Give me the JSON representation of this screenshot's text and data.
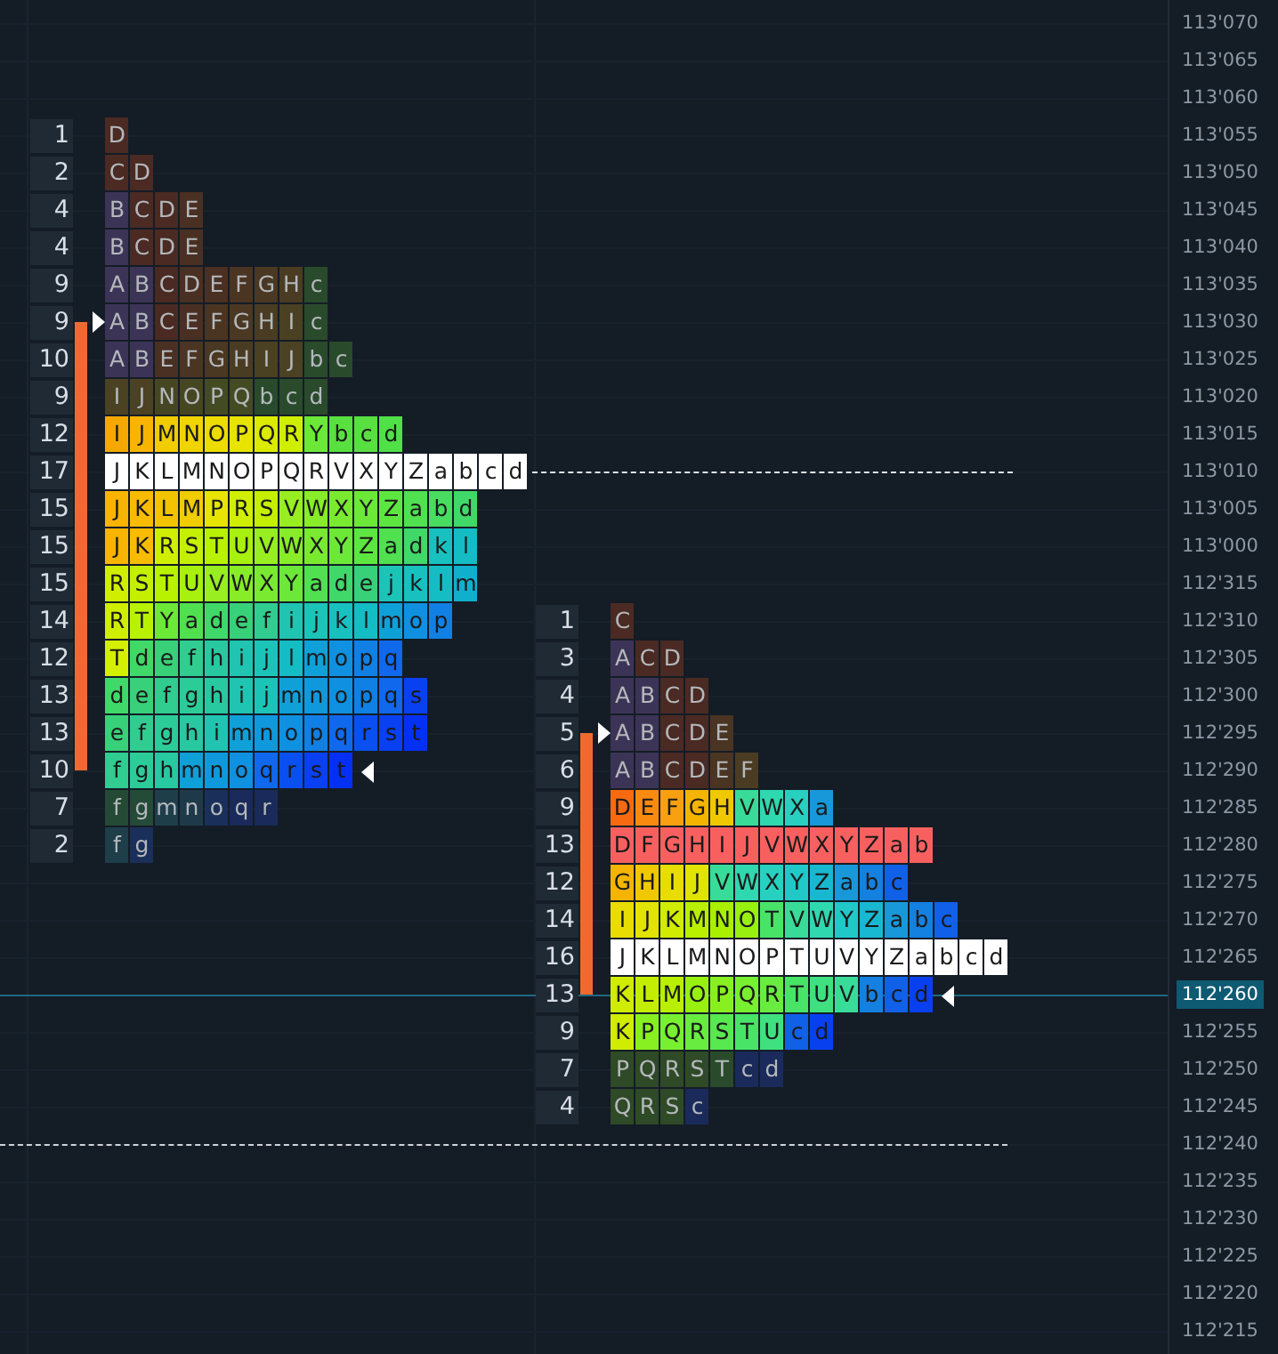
{
  "price_axis": {
    "labels": [
      {
        "text": "113'070",
        "selected": false
      },
      {
        "text": "113'065",
        "selected": false
      },
      {
        "text": "113'060",
        "selected": false
      },
      {
        "text": "113'055",
        "selected": false
      },
      {
        "text": "113'050",
        "selected": false
      },
      {
        "text": "113'045",
        "selected": false
      },
      {
        "text": "113'040",
        "selected": false
      },
      {
        "text": "113'035",
        "selected": false
      },
      {
        "text": "113'030",
        "selected": false
      },
      {
        "text": "113'025",
        "selected": false
      },
      {
        "text": "113'020",
        "selected": false
      },
      {
        "text": "113'015",
        "selected": false
      },
      {
        "text": "113'010",
        "selected": false
      },
      {
        "text": "113'005",
        "selected": false
      },
      {
        "text": "113'000",
        "selected": false
      },
      {
        "text": "112'315",
        "selected": false
      },
      {
        "text": "112'310",
        "selected": false
      },
      {
        "text": "112'305",
        "selected": false
      },
      {
        "text": "112'300",
        "selected": false
      },
      {
        "text": "112'295",
        "selected": false
      },
      {
        "text": "112'290",
        "selected": false
      },
      {
        "text": "112'285",
        "selected": false
      },
      {
        "text": "112'280",
        "selected": false
      },
      {
        "text": "112'275",
        "selected": false
      },
      {
        "text": "112'270",
        "selected": false
      },
      {
        "text": "112'265",
        "selected": false
      },
      {
        "text": "112'260",
        "selected": true
      },
      {
        "text": "112'255",
        "selected": false
      },
      {
        "text": "112'250",
        "selected": false
      },
      {
        "text": "112'245",
        "selected": false
      },
      {
        "text": "112'240",
        "selected": false
      },
      {
        "text": "112'235",
        "selected": false
      },
      {
        "text": "112'230",
        "selected": false
      },
      {
        "text": "112'225",
        "selected": false
      },
      {
        "text": "112'220",
        "selected": false
      },
      {
        "text": "112'215",
        "selected": false
      }
    ]
  },
  "profiles": [
    {
      "rows": [
        {
          "count": "1",
          "dim": true,
          "cells": [
            {
              "letter": "D",
              "color": "#4a2a22"
            }
          ]
        },
        {
          "count": "2",
          "dim": true,
          "cells": [
            {
              "letter": "C",
              "color": "#4a2a22"
            },
            {
              "letter": "D",
              "color": "#4a2a22"
            }
          ]
        },
        {
          "count": "4",
          "dim": true,
          "cells": [
            {
              "letter": "B",
              "color": "#3c3456"
            },
            {
              "letter": "C",
              "color": "#4a2a22"
            },
            {
              "letter": "D",
              "color": "#4a2a22"
            },
            {
              "letter": "E",
              "color": "#4a3022"
            }
          ]
        },
        {
          "count": "4",
          "dim": true,
          "cells": [
            {
              "letter": "B",
              "color": "#3c3456"
            },
            {
              "letter": "C",
              "color": "#4a2a22"
            },
            {
              "letter": "D",
              "color": "#4a2a22"
            },
            {
              "letter": "E",
              "color": "#4a3022"
            }
          ]
        },
        {
          "count": "9",
          "dim": true,
          "cells": [
            {
              "letter": "A",
              "color": "#3c3456"
            },
            {
              "letter": "B",
              "color": "#3c3456"
            },
            {
              "letter": "C",
              "color": "#4a2a22"
            },
            {
              "letter": "D",
              "color": "#4a3022"
            },
            {
              "letter": "E",
              "color": "#4a3022"
            },
            {
              "letter": "F",
              "color": "#4a3422"
            },
            {
              "letter": "G",
              "color": "#4a3822"
            },
            {
              "letter": "H",
              "color": "#4a3c22"
            },
            {
              "letter": "c",
              "color": "#2a4a2c"
            }
          ]
        },
        {
          "count": "9",
          "dim": true,
          "cells": [
            {
              "letter": "A",
              "color": "#3c3456"
            },
            {
              "letter": "B",
              "color": "#3c3456"
            },
            {
              "letter": "C",
              "color": "#4a2a22"
            },
            {
              "letter": "E",
              "color": "#4a3022"
            },
            {
              "letter": "F",
              "color": "#4a3422"
            },
            {
              "letter": "G",
              "color": "#4a3822"
            },
            {
              "letter": "H",
              "color": "#4a3c22"
            },
            {
              "letter": "I",
              "color": "#4a4022"
            },
            {
              "letter": "c",
              "color": "#2a4a2c"
            }
          ]
        },
        {
          "count": "10",
          "dim": true,
          "cells": [
            {
              "letter": "A",
              "color": "#3c3456"
            },
            {
              "letter": "B",
              "color": "#3c3456"
            },
            {
              "letter": "E",
              "color": "#4a3022"
            },
            {
              "letter": "F",
              "color": "#4a3422"
            },
            {
              "letter": "G",
              "color": "#4a3822"
            },
            {
              "letter": "H",
              "color": "#4a3c22"
            },
            {
              "letter": "I",
              "color": "#4a4022"
            },
            {
              "letter": "J",
              "color": "#4a4222"
            },
            {
              "letter": "b",
              "color": "#2a4a2c"
            },
            {
              "letter": "c",
              "color": "#2a4a2c"
            }
          ]
        },
        {
          "count": "9",
          "dim": true,
          "cells": [
            {
              "letter": "I",
              "color": "#4a4222"
            },
            {
              "letter": "J",
              "color": "#4a4222"
            },
            {
              "letter": "N",
              "color": "#464622"
            },
            {
              "letter": "O",
              "color": "#464622"
            },
            {
              "letter": "P",
              "color": "#444a22"
            },
            {
              "letter": "Q",
              "color": "#444a22"
            },
            {
              "letter": "b",
              "color": "#2a4a2c"
            },
            {
              "letter": "c",
              "color": "#2a4a2c"
            },
            {
              "letter": "d",
              "color": "#2a4a2c"
            }
          ]
        },
        {
          "count": "12",
          "dim": false,
          "cells": [
            {
              "letter": "I",
              "color": "#f5a800"
            },
            {
              "letter": "J",
              "color": "#f7b400"
            },
            {
              "letter": "M",
              "color": "#f0cc00"
            },
            {
              "letter": "N",
              "color": "#efd400"
            },
            {
              "letter": "O",
              "color": "#ecdc00"
            },
            {
              "letter": "P",
              "color": "#e6e400"
            },
            {
              "letter": "Q",
              "color": "#dcea00"
            },
            {
              "letter": "R",
              "color": "#d0ee00"
            },
            {
              "letter": "Y",
              "color": "#6ce838"
            },
            {
              "letter": "b",
              "color": "#58e040"
            },
            {
              "letter": "c",
              "color": "#58e040"
            },
            {
              "letter": "d",
              "color": "#50e048"
            }
          ]
        },
        {
          "count": "17",
          "dim": false,
          "cells": [
            {
              "letter": "J",
              "color": "#ffffff"
            },
            {
              "letter": "K",
              "color": "#ffffff"
            },
            {
              "letter": "L",
              "color": "#ffffff"
            },
            {
              "letter": "M",
              "color": "#ffffff"
            },
            {
              "letter": "N",
              "color": "#ffffff"
            },
            {
              "letter": "O",
              "color": "#ffffff"
            },
            {
              "letter": "P",
              "color": "#ffffff"
            },
            {
              "letter": "Q",
              "color": "#ffffff"
            },
            {
              "letter": "R",
              "color": "#ffffff"
            },
            {
              "letter": "V",
              "color": "#ffffff"
            },
            {
              "letter": "X",
              "color": "#ffffff"
            },
            {
              "letter": "Y",
              "color": "#ffffff"
            },
            {
              "letter": "Z",
              "color": "#ffffff"
            },
            {
              "letter": "a",
              "color": "#ffffff"
            },
            {
              "letter": "b",
              "color": "#ffffff"
            },
            {
              "letter": "c",
              "color": "#ffffff"
            },
            {
              "letter": "d",
              "color": "#ffffff"
            }
          ]
        },
        {
          "count": "15",
          "dim": false,
          "cells": [
            {
              "letter": "J",
              "color": "#f7b400"
            },
            {
              "letter": "K",
              "color": "#f7bc00"
            },
            {
              "letter": "L",
              "color": "#f2c400"
            },
            {
              "letter": "M",
              "color": "#f0cc00"
            },
            {
              "letter": "P",
              "color": "#e6e400"
            },
            {
              "letter": "R",
              "color": "#d0ee00"
            },
            {
              "letter": "S",
              "color": "#c4f000"
            },
            {
              "letter": "V",
              "color": "#98ee20"
            },
            {
              "letter": "W",
              "color": "#88ec28"
            },
            {
              "letter": "X",
              "color": "#7aea30"
            },
            {
              "letter": "Y",
              "color": "#6ce838"
            },
            {
              "letter": "Z",
              "color": "#5ee640"
            },
            {
              "letter": "a",
              "color": "#50e050"
            },
            {
              "letter": "b",
              "color": "#48dc60"
            },
            {
              "letter": "d",
              "color": "#40d868"
            }
          ]
        },
        {
          "count": "15",
          "dim": false,
          "cells": [
            {
              "letter": "J",
              "color": "#f7b400"
            },
            {
              "letter": "K",
              "color": "#f7bc00"
            },
            {
              "letter": "R",
              "color": "#d0ee00"
            },
            {
              "letter": "S",
              "color": "#c4f000"
            },
            {
              "letter": "T",
              "color": "#b8f200"
            },
            {
              "letter": "U",
              "color": "#a8f010"
            },
            {
              "letter": "V",
              "color": "#98ee20"
            },
            {
              "letter": "W",
              "color": "#88ec28"
            },
            {
              "letter": "X",
              "color": "#7aea30"
            },
            {
              "letter": "Y",
              "color": "#6ce838"
            },
            {
              "letter": "Z",
              "color": "#5ee640"
            },
            {
              "letter": "a",
              "color": "#50e050"
            },
            {
              "letter": "d",
              "color": "#40d868"
            },
            {
              "letter": "k",
              "color": "#18c0c0"
            },
            {
              "letter": "l",
              "color": "#14bcc4"
            }
          ]
        },
        {
          "count": "15",
          "dim": false,
          "cells": [
            {
              "letter": "R",
              "color": "#d0ee00"
            },
            {
              "letter": "S",
              "color": "#c4f000"
            },
            {
              "letter": "T",
              "color": "#b8f200"
            },
            {
              "letter": "U",
              "color": "#a8f010"
            },
            {
              "letter": "V",
              "color": "#98ee20"
            },
            {
              "letter": "W",
              "color": "#88ec28"
            },
            {
              "letter": "X",
              "color": "#7aea30"
            },
            {
              "letter": "Y",
              "color": "#6ce838"
            },
            {
              "letter": "a",
              "color": "#50e050"
            },
            {
              "letter": "d",
              "color": "#40d868"
            },
            {
              "letter": "e",
              "color": "#38d078"
            },
            {
              "letter": "j",
              "color": "#1cc4b8"
            },
            {
              "letter": "k",
              "color": "#18c0c0"
            },
            {
              "letter": "l",
              "color": "#14bcc4"
            },
            {
              "letter": "m",
              "color": "#10b0cc"
            }
          ]
        },
        {
          "count": "14",
          "dim": false,
          "cells": [
            {
              "letter": "R",
              "color": "#d0ee00"
            },
            {
              "letter": "T",
              "color": "#b8f200"
            },
            {
              "letter": "Y",
              "color": "#6ce838"
            },
            {
              "letter": "a",
              "color": "#50e050"
            },
            {
              "letter": "d",
              "color": "#40d868"
            },
            {
              "letter": "e",
              "color": "#38d078"
            },
            {
              "letter": "f",
              "color": "#30cc90"
            },
            {
              "letter": "i",
              "color": "#20c4b0"
            },
            {
              "letter": "j",
              "color": "#1cc4b8"
            },
            {
              "letter": "k",
              "color": "#18c0c0"
            },
            {
              "letter": "l",
              "color": "#14bcc4"
            },
            {
              "letter": "m",
              "color": "#10a0d8"
            },
            {
              "letter": "o",
              "color": "#1090e0"
            },
            {
              "letter": "p",
              "color": "#1080e4"
            }
          ]
        },
        {
          "count": "12",
          "dim": false,
          "cells": [
            {
              "letter": "T",
              "color": "#d4f000"
            },
            {
              "letter": "d",
              "color": "#40d868"
            },
            {
              "letter": "e",
              "color": "#38d078"
            },
            {
              "letter": "f",
              "color": "#30cc90"
            },
            {
              "letter": "h",
              "color": "#28c8a0"
            },
            {
              "letter": "i",
              "color": "#20c4b0"
            },
            {
              "letter": "j",
              "color": "#1cc4b8"
            },
            {
              "letter": "l",
              "color": "#14bcc4"
            },
            {
              "letter": "m",
              "color": "#10a0d8"
            },
            {
              "letter": "o",
              "color": "#1090e0"
            },
            {
              "letter": "p",
              "color": "#1080e4"
            },
            {
              "letter": "q",
              "color": "#1068ec"
            }
          ]
        },
        {
          "count": "13",
          "dim": false,
          "cells": [
            {
              "letter": "d",
              "color": "#40d868"
            },
            {
              "letter": "e",
              "color": "#38d078"
            },
            {
              "letter": "f",
              "color": "#30cc90"
            },
            {
              "letter": "g",
              "color": "#2ccc98"
            },
            {
              "letter": "h",
              "color": "#28c8a0"
            },
            {
              "letter": "i",
              "color": "#20c4b0"
            },
            {
              "letter": "j",
              "color": "#1cc4b8"
            },
            {
              "letter": "m",
              "color": "#10a0d8"
            },
            {
              "letter": "n",
              "color": "#1098dc"
            },
            {
              "letter": "o",
              "color": "#1090e0"
            },
            {
              "letter": "p",
              "color": "#1080e4"
            },
            {
              "letter": "q",
              "color": "#1068ec"
            },
            {
              "letter": "s",
              "color": "#0840f2"
            }
          ]
        },
        {
          "count": "13",
          "dim": false,
          "cells": [
            {
              "letter": "e",
              "color": "#38d078"
            },
            {
              "letter": "f",
              "color": "#30cc90"
            },
            {
              "letter": "g",
              "color": "#2ccc98"
            },
            {
              "letter": "h",
              "color": "#28c8a0"
            },
            {
              "letter": "i",
              "color": "#20c4b0"
            },
            {
              "letter": "m",
              "color": "#10a0d8"
            },
            {
              "letter": "n",
              "color": "#1098dc"
            },
            {
              "letter": "o",
              "color": "#1090e0"
            },
            {
              "letter": "p",
              "color": "#1080e4"
            },
            {
              "letter": "q",
              "color": "#1068ec"
            },
            {
              "letter": "r",
              "color": "#0a50f0"
            },
            {
              "letter": "s",
              "color": "#0840f2"
            },
            {
              "letter": "t",
              "color": "#0430f4"
            }
          ]
        },
        {
          "count": "10",
          "dim": false,
          "cells": [
            {
              "letter": "f",
              "color": "#30cc90"
            },
            {
              "letter": "g",
              "color": "#2ccc98"
            },
            {
              "letter": "h",
              "color": "#28c8a0"
            },
            {
              "letter": "m",
              "color": "#10a0d8"
            },
            {
              "letter": "n",
              "color": "#1098dc"
            },
            {
              "letter": "o",
              "color": "#1090e0"
            },
            {
              "letter": "q",
              "color": "#1068ec"
            },
            {
              "letter": "r",
              "color": "#0a50f0"
            },
            {
              "letter": "s",
              "color": "#0840f2"
            },
            {
              "letter": "t",
              "color": "#0430f4"
            }
          ]
        },
        {
          "count": "7",
          "dim": true,
          "cells": [
            {
              "letter": "f",
              "color": "#244a36"
            },
            {
              "letter": "g",
              "color": "#244a38"
            },
            {
              "letter": "m",
              "color": "#1e3e4a"
            },
            {
              "letter": "n",
              "color": "#1e3a4a"
            },
            {
              "letter": "o",
              "color": "#1a305a"
            },
            {
              "letter": "q",
              "color": "#1a2a5a"
            },
            {
              "letter": "r",
              "color": "#1a2a5a"
            }
          ]
        },
        {
          "count": "2",
          "dim": true,
          "cells": [
            {
              "letter": "f",
              "color": "#1e3e4a"
            },
            {
              "letter": "g",
              "color": "#1a305a"
            }
          ]
        }
      ]
    },
    {
      "rows": [
        {
          "count": "1",
          "dim": true,
          "cells": [
            {
              "letter": "C",
              "color": "#4a2a22"
            }
          ]
        },
        {
          "count": "3",
          "dim": true,
          "cells": [
            {
              "letter": "A",
              "color": "#3c3456"
            },
            {
              "letter": "C",
              "color": "#4a2a22"
            },
            {
              "letter": "D",
              "color": "#4a2a22"
            }
          ]
        },
        {
          "count": "4",
          "dim": true,
          "cells": [
            {
              "letter": "A",
              "color": "#3c3456"
            },
            {
              "letter": "B",
              "color": "#3c3456"
            },
            {
              "letter": "C",
              "color": "#4a2a22"
            },
            {
              "letter": "D",
              "color": "#4a2a22"
            }
          ]
        },
        {
          "count": "5",
          "dim": true,
          "cells": [
            {
              "letter": "A",
              "color": "#3c3456"
            },
            {
              "letter": "B",
              "color": "#3c3456"
            },
            {
              "letter": "C",
              "color": "#4a2a22"
            },
            {
              "letter": "D",
              "color": "#4a2a22"
            },
            {
              "letter": "E",
              "color": "#4a3422"
            }
          ]
        },
        {
          "count": "6",
          "dim": true,
          "cells": [
            {
              "letter": "A",
              "color": "#3c3456"
            },
            {
              "letter": "B",
              "color": "#3c3456"
            },
            {
              "letter": "C",
              "color": "#4a2a22"
            },
            {
              "letter": "D",
              "color": "#4a2a22"
            },
            {
              "letter": "E",
              "color": "#4a3422"
            },
            {
              "letter": "F",
              "color": "#4a3c22"
            }
          ]
        },
        {
          "count": "9",
          "dim": false,
          "cells": [
            {
              "letter": "D",
              "color": "#f86a10"
            },
            {
              "letter": "E",
              "color": "#f88a10"
            },
            {
              "letter": "F",
              "color": "#f8a010"
            },
            {
              "letter": "G",
              "color": "#f4b400"
            },
            {
              "letter": "H",
              "color": "#f0c800"
            },
            {
              "letter": "V",
              "color": "#38dc98"
            },
            {
              "letter": "W",
              "color": "#30d8b0"
            },
            {
              "letter": "X",
              "color": "#28d0c0"
            },
            {
              "letter": "a",
              "color": "#1898d8"
            }
          ]
        },
        {
          "count": "13",
          "dim": false,
          "cells": [
            {
              "letter": "D",
              "color": "#f86060"
            },
            {
              "letter": "F",
              "color": "#f86060"
            },
            {
              "letter": "G",
              "color": "#f86060"
            },
            {
              "letter": "H",
              "color": "#f86060"
            },
            {
              "letter": "I",
              "color": "#f86060"
            },
            {
              "letter": "J",
              "color": "#f86060"
            },
            {
              "letter": "V",
              "color": "#f86060"
            },
            {
              "letter": "W",
              "color": "#f86060"
            },
            {
              "letter": "X",
              "color": "#f86060"
            },
            {
              "letter": "Y",
              "color": "#f86060"
            },
            {
              "letter": "Z",
              "color": "#f86060"
            },
            {
              "letter": "a",
              "color": "#f86060"
            },
            {
              "letter": "b",
              "color": "#f86060"
            }
          ]
        },
        {
          "count": "12",
          "dim": false,
          "cells": [
            {
              "letter": "G",
              "color": "#f4b400"
            },
            {
              "letter": "H",
              "color": "#f0c800"
            },
            {
              "letter": "I",
              "color": "#e8dc00"
            },
            {
              "letter": "J",
              "color": "#e0e400"
            },
            {
              "letter": "V",
              "color": "#38dc98"
            },
            {
              "letter": "W",
              "color": "#30d8b0"
            },
            {
              "letter": "X",
              "color": "#28d0c0"
            },
            {
              "letter": "Y",
              "color": "#20c8c8"
            },
            {
              "letter": "Z",
              "color": "#18b8d0"
            },
            {
              "letter": "a",
              "color": "#1898d8"
            },
            {
              "letter": "b",
              "color": "#1480e0"
            },
            {
              "letter": "c",
              "color": "#1060e8"
            }
          ]
        },
        {
          "count": "14",
          "dim": false,
          "cells": [
            {
              "letter": "I",
              "color": "#e8dc00"
            },
            {
              "letter": "J",
              "color": "#e0e400"
            },
            {
              "letter": "K",
              "color": "#d0ec00"
            },
            {
              "letter": "M",
              "color": "#b8f000"
            },
            {
              "letter": "N",
              "color": "#a8f000"
            },
            {
              "letter": "O",
              "color": "#98f010"
            },
            {
              "letter": "T",
              "color": "#48e468"
            },
            {
              "letter": "V",
              "color": "#38dc98"
            },
            {
              "letter": "W",
              "color": "#30d8b0"
            },
            {
              "letter": "Y",
              "color": "#20c8c8"
            },
            {
              "letter": "Z",
              "color": "#18b8d0"
            },
            {
              "letter": "a",
              "color": "#1898d8"
            },
            {
              "letter": "b",
              "color": "#1480e0"
            },
            {
              "letter": "c",
              "color": "#1060e8"
            }
          ]
        },
        {
          "count": "16",
          "dim": false,
          "cells": [
            {
              "letter": "J",
              "color": "#ffffff"
            },
            {
              "letter": "K",
              "color": "#ffffff"
            },
            {
              "letter": "L",
              "color": "#ffffff"
            },
            {
              "letter": "M",
              "color": "#ffffff"
            },
            {
              "letter": "N",
              "color": "#ffffff"
            },
            {
              "letter": "O",
              "color": "#ffffff"
            },
            {
              "letter": "P",
              "color": "#ffffff"
            },
            {
              "letter": "T",
              "color": "#ffffff"
            },
            {
              "letter": "U",
              "color": "#ffffff"
            },
            {
              "letter": "V",
              "color": "#ffffff"
            },
            {
              "letter": "Y",
              "color": "#ffffff"
            },
            {
              "letter": "Z",
              "color": "#ffffff"
            },
            {
              "letter": "a",
              "color": "#ffffff"
            },
            {
              "letter": "b",
              "color": "#ffffff"
            },
            {
              "letter": "c",
              "color": "#ffffff"
            },
            {
              "letter": "d",
              "color": "#ffffff"
            }
          ]
        },
        {
          "count": "13",
          "dim": false,
          "cells": [
            {
              "letter": "K",
              "color": "#d0ec00"
            },
            {
              "letter": "L",
              "color": "#c4ee00"
            },
            {
              "letter": "M",
              "color": "#b8f000"
            },
            {
              "letter": "O",
              "color": "#98f010"
            },
            {
              "letter": "P",
              "color": "#88f020"
            },
            {
              "letter": "Q",
              "color": "#78f030"
            },
            {
              "letter": "R",
              "color": "#68ec40"
            },
            {
              "letter": "T",
              "color": "#48e468"
            },
            {
              "letter": "U",
              "color": "#40e080"
            },
            {
              "letter": "V",
              "color": "#38dc98"
            },
            {
              "letter": "b",
              "color": "#1480e0"
            },
            {
              "letter": "c",
              "color": "#1060e8"
            },
            {
              "letter": "d",
              "color": "#0840f0"
            }
          ]
        },
        {
          "count": "9",
          "dim": false,
          "cells": [
            {
              "letter": "K",
              "color": "#d0ec00"
            },
            {
              "letter": "P",
              "color": "#88f020"
            },
            {
              "letter": "Q",
              "color": "#78f030"
            },
            {
              "letter": "R",
              "color": "#68ec40"
            },
            {
              "letter": "S",
              "color": "#58e850"
            },
            {
              "letter": "T",
              "color": "#48e468"
            },
            {
              "letter": "U",
              "color": "#40e080"
            },
            {
              "letter": "c",
              "color": "#1060e8"
            },
            {
              "letter": "d",
              "color": "#0840f0"
            }
          ]
        },
        {
          "count": "7",
          "dim": true,
          "cells": [
            {
              "letter": "P",
              "color": "#2e4a26"
            },
            {
              "letter": "Q",
              "color": "#2e4a26"
            },
            {
              "letter": "R",
              "color": "#2e4a26"
            },
            {
              "letter": "S",
              "color": "#2e4a26"
            },
            {
              "letter": "T",
              "color": "#2a4a2c"
            },
            {
              "letter": "c",
              "color": "#1a2a5a"
            },
            {
              "letter": "d",
              "color": "#1a2a5a"
            }
          ]
        },
        {
          "count": "4",
          "dim": true,
          "cells": [
            {
              "letter": "Q",
              "color": "#2e4a26"
            },
            {
              "letter": "R",
              "color": "#2e4a26"
            },
            {
              "letter": "S",
              "color": "#2e4a26"
            },
            {
              "letter": "c",
              "color": "#1a2a5a"
            }
          ]
        }
      ]
    }
  ]
}
